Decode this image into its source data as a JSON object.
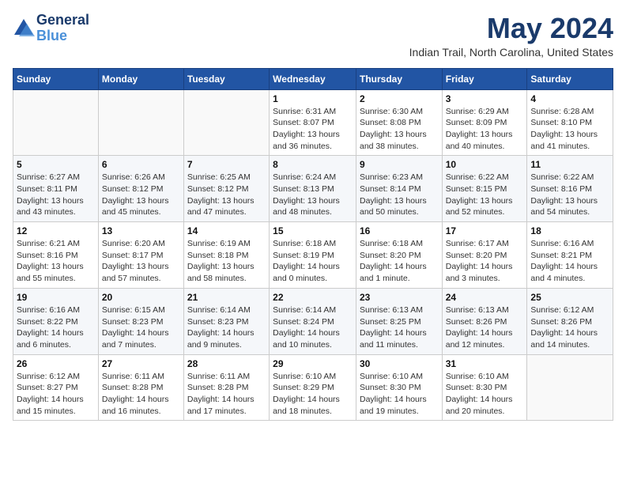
{
  "header": {
    "logo_line1": "General",
    "logo_line2": "Blue",
    "month": "May 2024",
    "location": "Indian Trail, North Carolina, United States"
  },
  "weekdays": [
    "Sunday",
    "Monday",
    "Tuesday",
    "Wednesday",
    "Thursday",
    "Friday",
    "Saturday"
  ],
  "weeks": [
    [
      {
        "day": "",
        "info": ""
      },
      {
        "day": "",
        "info": ""
      },
      {
        "day": "",
        "info": ""
      },
      {
        "day": "1",
        "info": "Sunrise: 6:31 AM\nSunset: 8:07 PM\nDaylight: 13 hours\nand 36 minutes."
      },
      {
        "day": "2",
        "info": "Sunrise: 6:30 AM\nSunset: 8:08 PM\nDaylight: 13 hours\nand 38 minutes."
      },
      {
        "day": "3",
        "info": "Sunrise: 6:29 AM\nSunset: 8:09 PM\nDaylight: 13 hours\nand 40 minutes."
      },
      {
        "day": "4",
        "info": "Sunrise: 6:28 AM\nSunset: 8:10 PM\nDaylight: 13 hours\nand 41 minutes."
      }
    ],
    [
      {
        "day": "5",
        "info": "Sunrise: 6:27 AM\nSunset: 8:11 PM\nDaylight: 13 hours\nand 43 minutes."
      },
      {
        "day": "6",
        "info": "Sunrise: 6:26 AM\nSunset: 8:12 PM\nDaylight: 13 hours\nand 45 minutes."
      },
      {
        "day": "7",
        "info": "Sunrise: 6:25 AM\nSunset: 8:12 PM\nDaylight: 13 hours\nand 47 minutes."
      },
      {
        "day": "8",
        "info": "Sunrise: 6:24 AM\nSunset: 8:13 PM\nDaylight: 13 hours\nand 48 minutes."
      },
      {
        "day": "9",
        "info": "Sunrise: 6:23 AM\nSunset: 8:14 PM\nDaylight: 13 hours\nand 50 minutes."
      },
      {
        "day": "10",
        "info": "Sunrise: 6:22 AM\nSunset: 8:15 PM\nDaylight: 13 hours\nand 52 minutes."
      },
      {
        "day": "11",
        "info": "Sunrise: 6:22 AM\nSunset: 8:16 PM\nDaylight: 13 hours\nand 54 minutes."
      }
    ],
    [
      {
        "day": "12",
        "info": "Sunrise: 6:21 AM\nSunset: 8:16 PM\nDaylight: 13 hours\nand 55 minutes."
      },
      {
        "day": "13",
        "info": "Sunrise: 6:20 AM\nSunset: 8:17 PM\nDaylight: 13 hours\nand 57 minutes."
      },
      {
        "day": "14",
        "info": "Sunrise: 6:19 AM\nSunset: 8:18 PM\nDaylight: 13 hours\nand 58 minutes."
      },
      {
        "day": "15",
        "info": "Sunrise: 6:18 AM\nSunset: 8:19 PM\nDaylight: 14 hours\nand 0 minutes."
      },
      {
        "day": "16",
        "info": "Sunrise: 6:18 AM\nSunset: 8:20 PM\nDaylight: 14 hours\nand 1 minute."
      },
      {
        "day": "17",
        "info": "Sunrise: 6:17 AM\nSunset: 8:20 PM\nDaylight: 14 hours\nand 3 minutes."
      },
      {
        "day": "18",
        "info": "Sunrise: 6:16 AM\nSunset: 8:21 PM\nDaylight: 14 hours\nand 4 minutes."
      }
    ],
    [
      {
        "day": "19",
        "info": "Sunrise: 6:16 AM\nSunset: 8:22 PM\nDaylight: 14 hours\nand 6 minutes."
      },
      {
        "day": "20",
        "info": "Sunrise: 6:15 AM\nSunset: 8:23 PM\nDaylight: 14 hours\nand 7 minutes."
      },
      {
        "day": "21",
        "info": "Sunrise: 6:14 AM\nSunset: 8:23 PM\nDaylight: 14 hours\nand 9 minutes."
      },
      {
        "day": "22",
        "info": "Sunrise: 6:14 AM\nSunset: 8:24 PM\nDaylight: 14 hours\nand 10 minutes."
      },
      {
        "day": "23",
        "info": "Sunrise: 6:13 AM\nSunset: 8:25 PM\nDaylight: 14 hours\nand 11 minutes."
      },
      {
        "day": "24",
        "info": "Sunrise: 6:13 AM\nSunset: 8:26 PM\nDaylight: 14 hours\nand 12 minutes."
      },
      {
        "day": "25",
        "info": "Sunrise: 6:12 AM\nSunset: 8:26 PM\nDaylight: 14 hours\nand 14 minutes."
      }
    ],
    [
      {
        "day": "26",
        "info": "Sunrise: 6:12 AM\nSunset: 8:27 PM\nDaylight: 14 hours\nand 15 minutes."
      },
      {
        "day": "27",
        "info": "Sunrise: 6:11 AM\nSunset: 8:28 PM\nDaylight: 14 hours\nand 16 minutes."
      },
      {
        "day": "28",
        "info": "Sunrise: 6:11 AM\nSunset: 8:28 PM\nDaylight: 14 hours\nand 17 minutes."
      },
      {
        "day": "29",
        "info": "Sunrise: 6:10 AM\nSunset: 8:29 PM\nDaylight: 14 hours\nand 18 minutes."
      },
      {
        "day": "30",
        "info": "Sunrise: 6:10 AM\nSunset: 8:30 PM\nDaylight: 14 hours\nand 19 minutes."
      },
      {
        "day": "31",
        "info": "Sunrise: 6:10 AM\nSunset: 8:30 PM\nDaylight: 14 hours\nand 20 minutes."
      },
      {
        "day": "",
        "info": ""
      }
    ]
  ]
}
